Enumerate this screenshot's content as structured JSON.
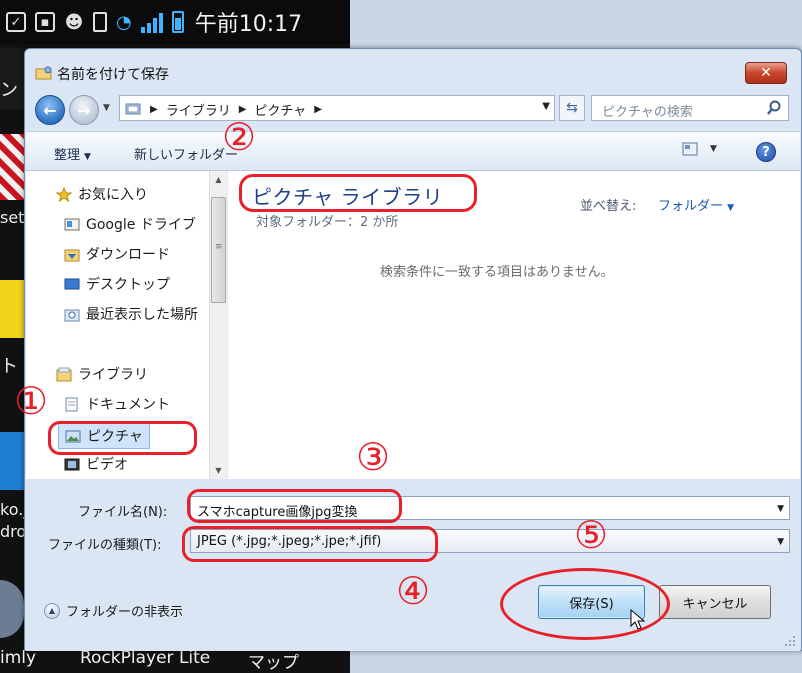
{
  "status_bar": {
    "time": "午前10:17"
  },
  "background_apps": {
    "side_labels": [
      "ン",
      "set",
      "ト",
      "ko.j",
      "dro"
    ],
    "dock": [
      "imly",
      "RockPlayer Lite",
      "マップ"
    ]
  },
  "dialog": {
    "title": "名前を付けて保存",
    "close_symbol": "✕",
    "address": {
      "crumbs": [
        "ライブラリ",
        "ピクチャ"
      ]
    },
    "search_placeholder": "ピクチャの検索",
    "toolbar": {
      "organize": "整理",
      "new_folder": "新しいフォルダー"
    },
    "nav": {
      "favorites": "お気に入り",
      "favorites_items": [
        "Google ドライブ",
        "ダウンロード",
        "デスクトップ",
        "最近表示した場所"
      ],
      "libraries": "ライブラリ",
      "library_items": [
        "ドキュメント",
        "ピクチャ",
        "ビデオ"
      ]
    },
    "content": {
      "library_title": "ピクチャ ライブラリ",
      "target_folders": "対象フォルダー：2 か所",
      "sort_label": "並べ替え:",
      "sort_value": "フォルダー",
      "empty_message": "検索条件に一致する項目はありません。"
    },
    "form": {
      "filename_label": "ファイル名(N):",
      "filename_value": "スマホcapture画像jpg変換",
      "filetype_label": "ファイルの種類(T):",
      "filetype_value": "JPEG (*.jpg;*.jpeg;*.jpe;*.jfif)",
      "hide_folders": "フォルダーの非表示",
      "save": "保存(S)",
      "cancel": "キャンセル"
    }
  },
  "annotations": {
    "numbers": [
      "①",
      "②",
      "③",
      "④",
      "⑤"
    ],
    "color": "#e8202a"
  }
}
